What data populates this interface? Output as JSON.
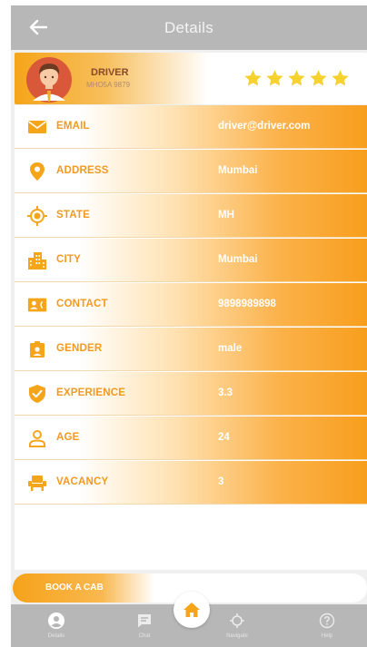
{
  "header": {
    "title": "Details",
    "back_icon": "arrow-left-icon"
  },
  "profile": {
    "name": "DRIVER",
    "plate": "MHO5A 9879",
    "rating": 5,
    "star_color": "#f7d12d"
  },
  "details": [
    {
      "icon": "email-icon",
      "label": "EMAIL",
      "value": "driver@driver.com"
    },
    {
      "icon": "location-pin-icon",
      "label": "ADDRESS",
      "value": "Mumbai"
    },
    {
      "icon": "target-icon",
      "label": "STATE",
      "value": "MH"
    },
    {
      "icon": "city-buildings-icon",
      "label": "CITY",
      "value": "Mumbai"
    },
    {
      "icon": "contact-card-icon",
      "label": "CONTACT",
      "value": "9898989898"
    },
    {
      "icon": "id-badge-icon",
      "label": "GENDER",
      "value": "male"
    },
    {
      "icon": "shield-check-icon",
      "label": "EXPERIENCE",
      "value": "3.3"
    },
    {
      "icon": "person-icon",
      "label": "AGE",
      "value": "24"
    },
    {
      "icon": "seat-icon",
      "label": "VACANCY",
      "value": "3"
    }
  ],
  "book_button": {
    "label": "BOOK A CAB"
  },
  "bottom_nav": [
    {
      "icon": "user-circle-icon",
      "label": "Details",
      "active": true
    },
    {
      "icon": "chat-icon",
      "label": "Chat",
      "active": false
    },
    {
      "icon": "navigate-icon",
      "label": "Navigate",
      "active": false
    },
    {
      "icon": "help-icon",
      "label": "Help",
      "active": false
    }
  ],
  "home_fab": {
    "icon": "home-icon"
  },
  "colors": {
    "accent": "#f5a51a",
    "header_bg": "#b7b7b7",
    "label_color": "#f29a1e"
  }
}
